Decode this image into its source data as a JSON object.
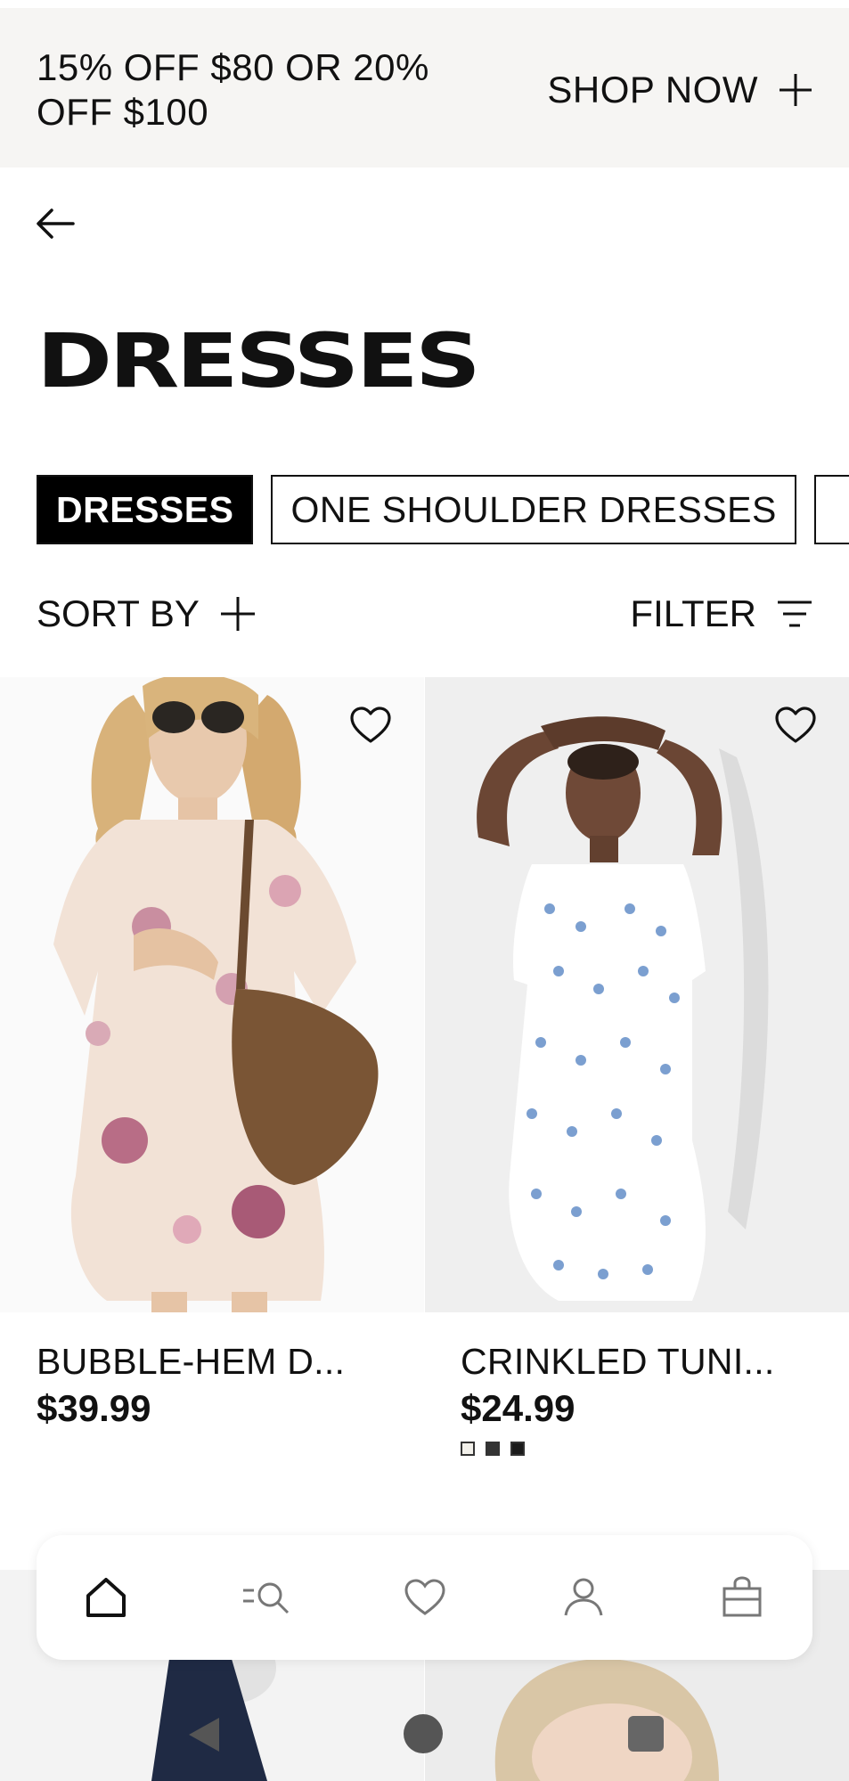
{
  "promo": {
    "text": "15% OFF $80 OR 20% OFF $100",
    "cta": "SHOP NOW"
  },
  "header": {
    "back_icon": "arrow-left-icon"
  },
  "page": {
    "title": "DRESSES"
  },
  "chips": [
    {
      "label": "DRESSES",
      "active": true
    },
    {
      "label": "ONE SHOULDER DRESSES",
      "active": false
    }
  ],
  "toolbar": {
    "sort_label": "SORT BY",
    "filter_label": "FILTER"
  },
  "products": [
    {
      "name": "BUBBLE-HEM D...",
      "price": "$39.99",
      "swatches": []
    },
    {
      "name": "CRINKLED TUNI...",
      "price": "$24.99",
      "swatches": [
        "#f2f0ea",
        "#333333",
        "#1b1b1b"
      ]
    }
  ],
  "bottom_nav": {
    "items": [
      "home-icon",
      "search-menu-icon",
      "heart-icon",
      "account-icon",
      "bag-icon"
    ]
  },
  "colors": {
    "promo_bg": "#f6f5f3",
    "chip_active_bg": "#000000",
    "text": "#111111"
  }
}
